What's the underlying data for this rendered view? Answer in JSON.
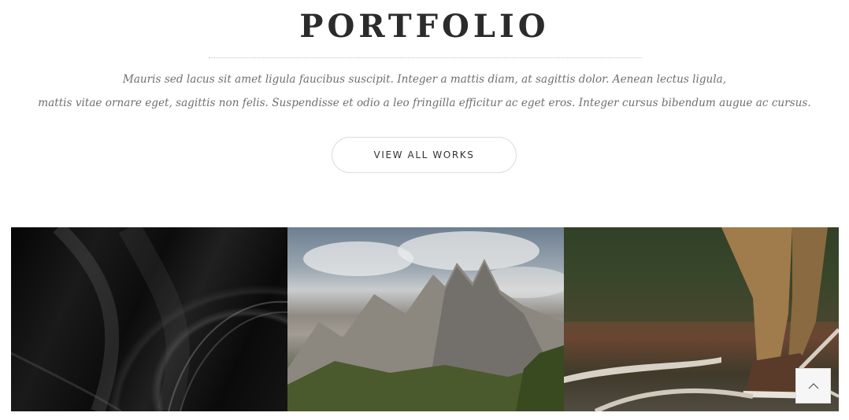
{
  "section": {
    "title": "PORTFOLIO",
    "intro_line_1": "Mauris sed lacus sit amet ligula faucibus suscipit. Integer a mattis diam, at sagittis dolor. Aenean lectus ligula,",
    "intro_line_2": "mattis vitae ornare eget, sagittis non felis. Suspendisse et odio a leo fringilla efficitur ac eget eros. Integer cursus bibendum augue ac cursus.",
    "button_label": "VIEW ALL WORKS"
  },
  "gallery": {
    "items": [
      {
        "subject": "abstract-dark-curves"
      },
      {
        "subject": "mountain-landscape"
      },
      {
        "subject": "hiker-boots-branches"
      }
    ]
  },
  "scroll_top": {
    "icon": "chevron-up-icon"
  }
}
